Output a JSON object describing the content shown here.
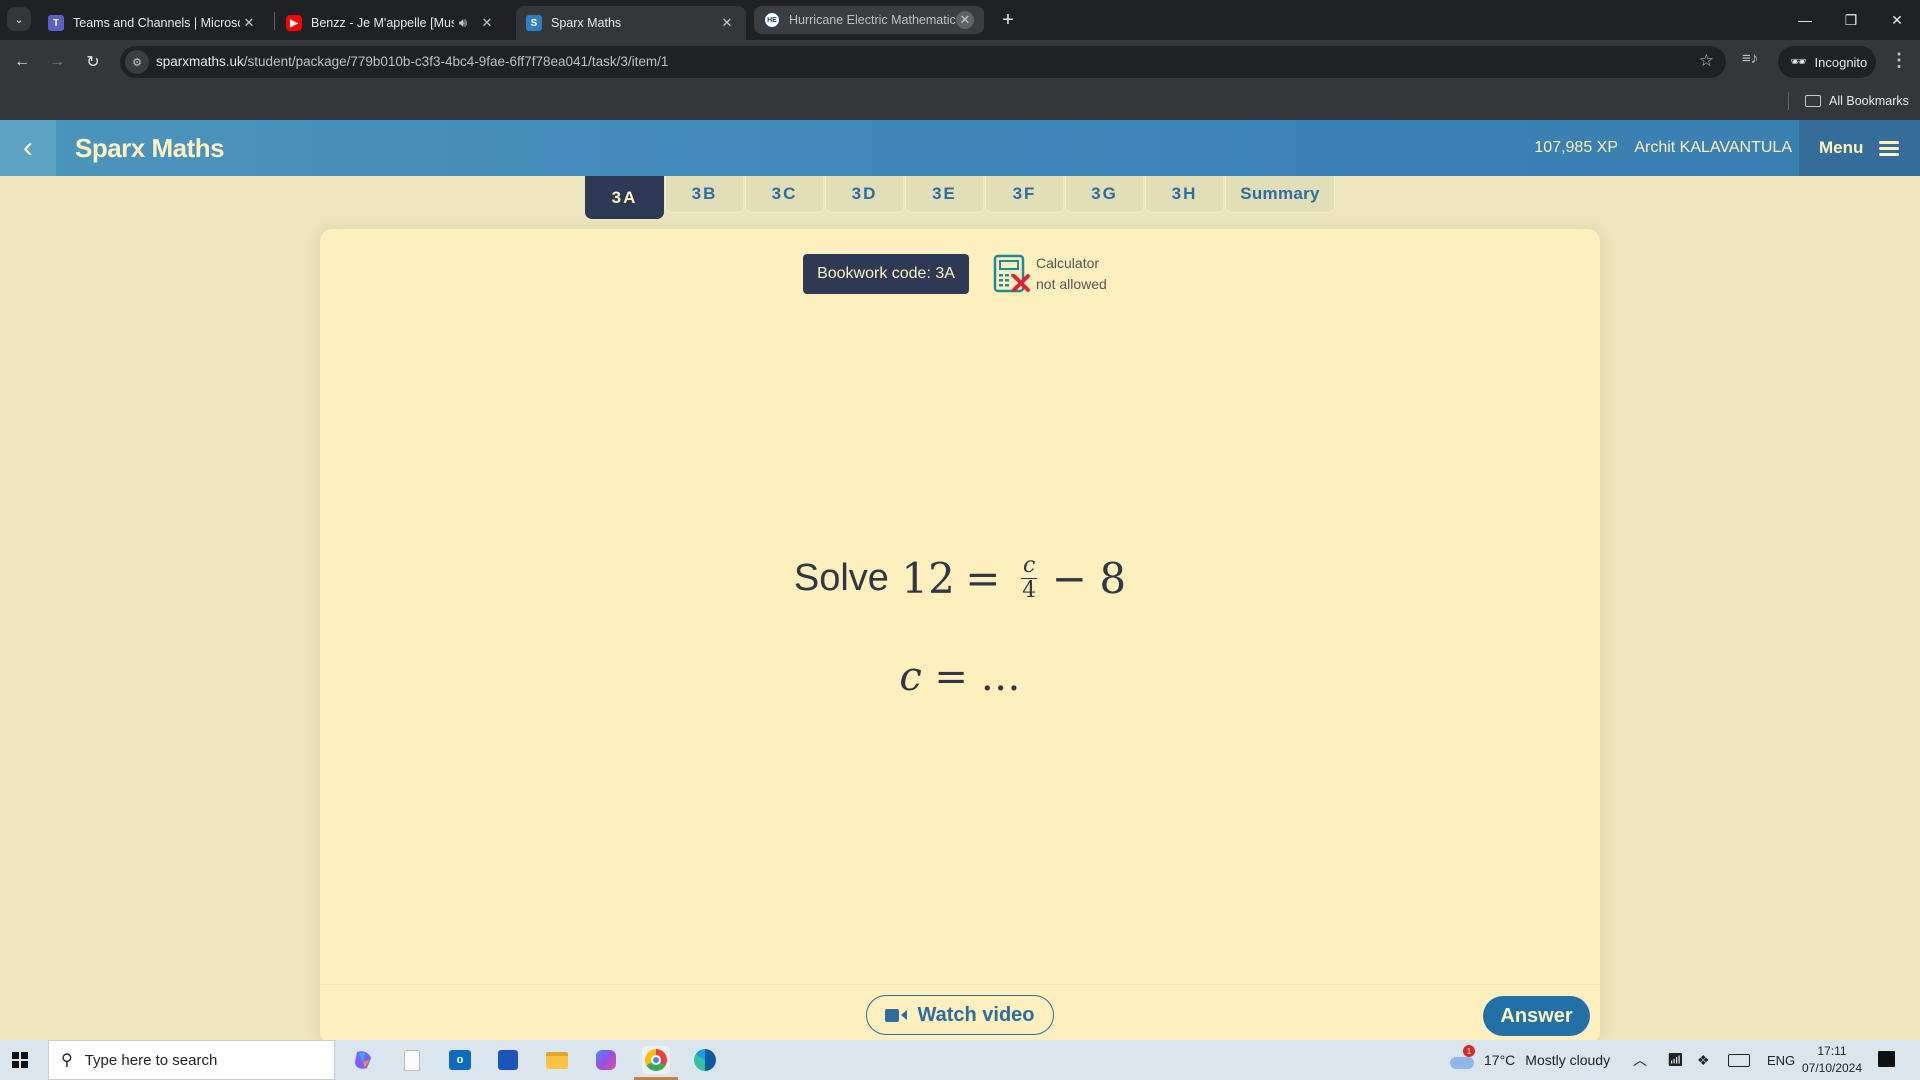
{
  "browser": {
    "tabs": [
      {
        "title": "Teams and Channels | Microsoft",
        "icon": "teams-icon",
        "active": false
      },
      {
        "title": "Benzz - Je M'appelle [Music",
        "icon": "youtube-icon",
        "active": false,
        "audio": true
      },
      {
        "title": "Sparx Maths",
        "icon": "sparx-icon",
        "active": true
      },
      {
        "title": "Hurricane Electric Mathematics",
        "icon": "he-icon",
        "active": false
      }
    ],
    "favicon_letters": {
      "sparx": "S",
      "he": "HE"
    },
    "url_domain": "sparxmaths.uk",
    "url_path": "/student/package/779b010b-c3f3-4bc4-9fae-6ff7f78ea041/task/3/item/1",
    "incognito_label": "Incognito",
    "all_bookmarks_label": "All Bookmarks"
  },
  "app": {
    "title": "Sparx Maths",
    "xp": "107,985 XP",
    "user_name": "Archit KALAVANTULA",
    "menu_label": "Menu",
    "task_tabs": [
      {
        "label": "3A",
        "active": true
      },
      {
        "label": "3B"
      },
      {
        "label": "3C"
      },
      {
        "label": "3D"
      },
      {
        "label": "3E"
      },
      {
        "label": "3F"
      },
      {
        "label": "3G"
      },
      {
        "label": "3H"
      },
      {
        "label": "Summary"
      }
    ],
    "colors": {
      "header_blue": "#3a82b5",
      "navy": "#2e3a55",
      "cream": "#fdf0be",
      "accent_blue": "#2271a6",
      "calculator_teal": "#1f8a95",
      "calculator_cross": "#d62839"
    }
  },
  "question": {
    "bookwork_code": "Bookwork code: 3A",
    "calculator_line1": "Calculator",
    "calculator_line2": "not allowed",
    "prompt_word": "Solve",
    "lhs": "12",
    "equals": "=",
    "frac_num": "c",
    "frac_den": "4",
    "minus": "−",
    "constant": "8",
    "answer_var": "c",
    "answer_rest": " = …",
    "watch_video_label": "Watch video",
    "answer_label": "Answer"
  },
  "taskbar": {
    "search_placeholder": "Type here to search",
    "weather_badge": "1",
    "temperature": "17°C",
    "weather": "Mostly cloudy",
    "language": "ENG",
    "time": "17:11",
    "date": "07/10/2024"
  }
}
